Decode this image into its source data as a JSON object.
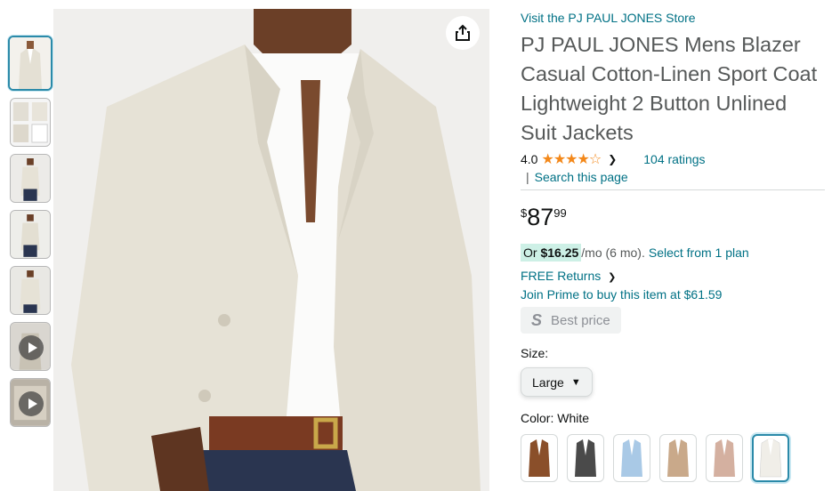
{
  "product": {
    "store_link": "Visit the PJ PAUL JONES Store",
    "title": "PJ PAUL JONES Mens Blazer Casual Cotton-Linen Sport Coat Lightweight 2 Button Unlined Suit Jackets",
    "rating_value": "4.0",
    "stars_display": "★★★★☆",
    "rating_count": "104 ratings",
    "search_link": "Search this page",
    "price": {
      "symbol": "$",
      "whole": "87",
      "fraction": "99"
    },
    "monthly": {
      "prefix": "Or ",
      "amount": "$16.25",
      "per": " /mo (6 mo).",
      "plan_link": "Select from 1 plan"
    },
    "returns": "FREE Returns",
    "prime": "Join Prime to buy this item at $61.59",
    "best_price": {
      "icon": "S",
      "label": "Best price"
    },
    "size": {
      "label": "Size:",
      "selected": "Large"
    },
    "color": {
      "label": "Color: ",
      "selected": "White"
    }
  },
  "swatch_colors": [
    "#8a4f2a",
    "#4a4a4a",
    "#a9c9e6",
    "#c9a98a",
    "#d4b0a0",
    "#f0eee8"
  ],
  "thumbnails": [
    {
      "type": "image",
      "icon": "blazer-front"
    },
    {
      "type": "image",
      "icon": "detail-collage"
    },
    {
      "type": "image",
      "icon": "model-full"
    },
    {
      "type": "image",
      "icon": "model-side"
    },
    {
      "type": "image",
      "icon": "model-back"
    },
    {
      "type": "video",
      "icon": "play-icon"
    },
    {
      "type": "video",
      "icon": "play-icon"
    }
  ],
  "colors": {
    "link": "#007185",
    "accent": "#f3881a",
    "selected_border": "#2b8aa9"
  }
}
